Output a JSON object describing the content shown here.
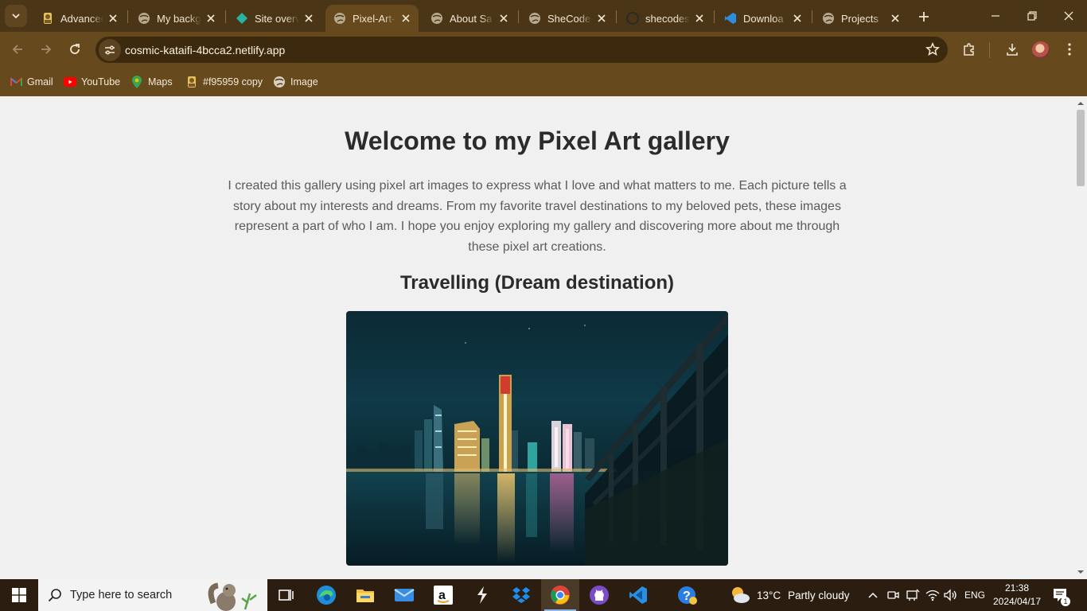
{
  "browser": {
    "tabs": [
      {
        "title": "Advanced",
        "icon": "user-avatar-icon",
        "active": false
      },
      {
        "title": "My backg",
        "icon": "globe-icon",
        "active": false
      },
      {
        "title": "Site overv",
        "icon": "netlify-icon",
        "active": false
      },
      {
        "title": "Pixel-Art-",
        "icon": "globe-icon",
        "active": true
      },
      {
        "title": "About Sa",
        "icon": "globe-icon",
        "active": false
      },
      {
        "title": "SheCodes",
        "icon": "globe-icon",
        "active": false
      },
      {
        "title": "shecodes",
        "icon": "github-icon",
        "active": false
      },
      {
        "title": "Downloa",
        "icon": "vscode-icon",
        "active": false
      },
      {
        "title": "Projects",
        "icon": "globe-icon",
        "active": false
      }
    ],
    "url": "cosmic-kataifi-4bcca2.netlify.app",
    "bookmarks": [
      {
        "label": "Gmail",
        "icon": "gmail-icon"
      },
      {
        "label": "YouTube",
        "icon": "youtube-icon"
      },
      {
        "label": "Maps",
        "icon": "maps-icon"
      },
      {
        "label": "#f95959 copy",
        "icon": "user-avatar-icon"
      },
      {
        "label": "Image",
        "icon": "globe-icon"
      }
    ],
    "accent_color": "#67491e",
    "frame_color": "#4a3616"
  },
  "page": {
    "title": "Welcome to my Pixel Art gallery",
    "intro": "I created this gallery using pixel art images to express what I love and what matters to me. Each picture tells a story about my interests and dreams. From my favorite travel destinations to my beloved pets, these images represent a part of who I am. I hope you enjoy exploring my gallery and discovering more about me through these pixel art creations.",
    "section_heading": "Travelling (Dream destination)",
    "photo_icon": "city-skyline-night-photo"
  },
  "taskbar": {
    "search_placeholder": "Type here to search",
    "apps": [
      "task-view-icon",
      "edge-icon",
      "file-explorer-icon",
      "mail-icon",
      "amazon-icon",
      "lightning-app-icon",
      "dropbox-icon",
      "chrome-icon",
      "github-desktop-icon",
      "vscode-icon",
      "help-icon"
    ],
    "weather_temp": "13°C",
    "weather_text": "Partly cloudy",
    "language": "ENG",
    "time": "21:38",
    "date": "2024/04/17",
    "notification_count": "1"
  }
}
